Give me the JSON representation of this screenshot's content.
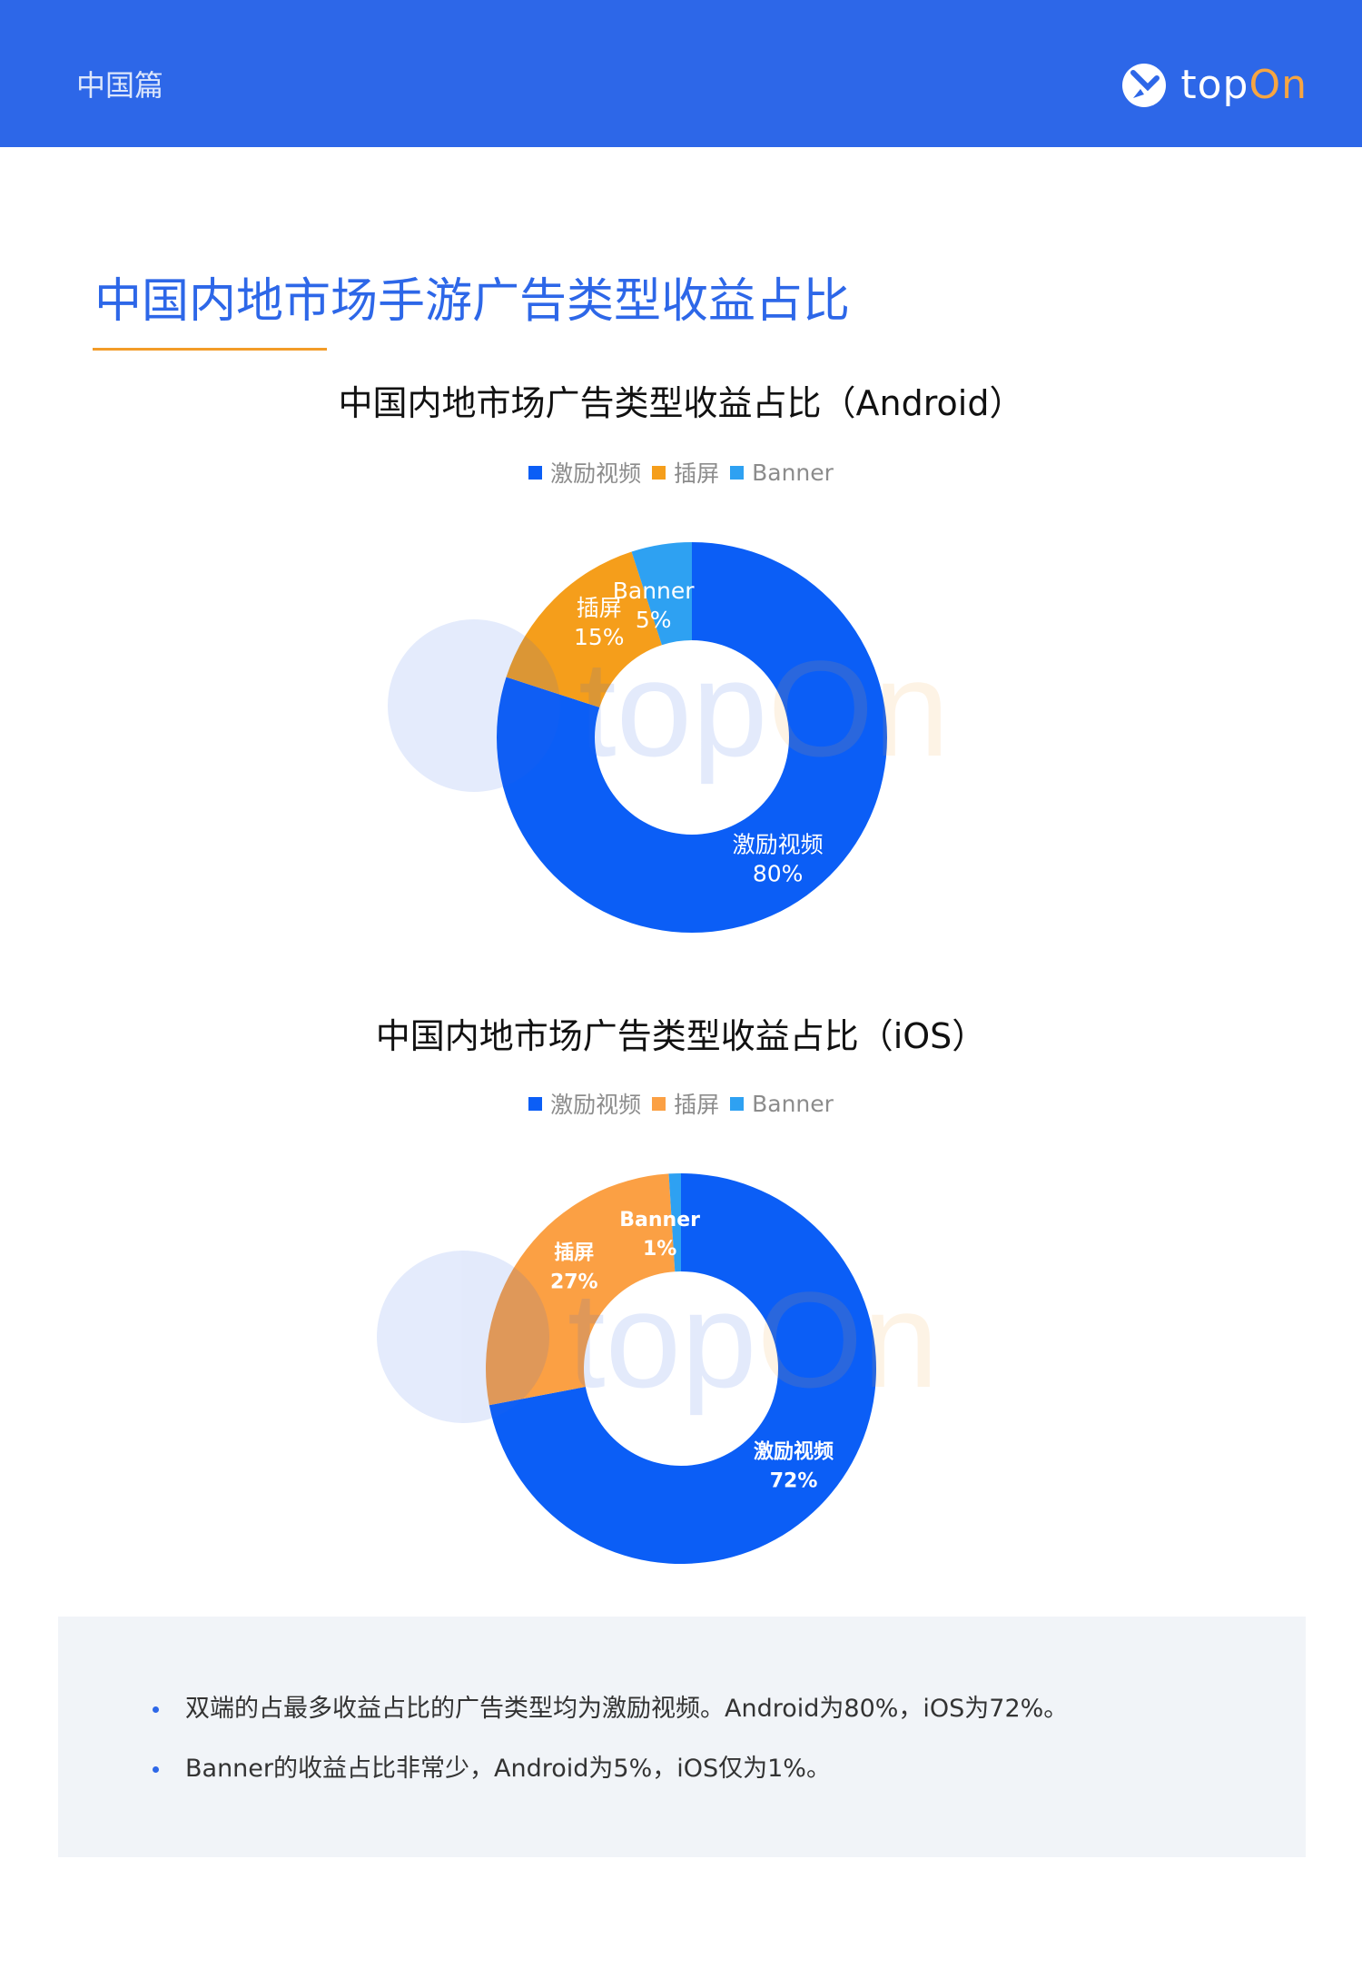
{
  "header": {
    "section": "中国篇",
    "brand_prefix": "top",
    "brand_suffix": "On",
    "brand_color": "#2d67e8",
    "accent_color": "#f7a541"
  },
  "page_title": "中国内地市场手游广告类型收益占比",
  "chart_data": [
    {
      "type": "pie",
      "variant": "donut",
      "title": "中国内地市场广告类型收益占比（Android）",
      "legend_position": "top",
      "categories": [
        "激励视频",
        "插屏",
        "Banner"
      ],
      "values": [
        80,
        15,
        5
      ],
      "labels": [
        "80%",
        "15%",
        "5%"
      ],
      "colors": [
        "#0b5ef6",
        "#f59e1b",
        "#2ea1f2"
      ]
    },
    {
      "type": "pie",
      "variant": "donut",
      "title": "中国内地市场广告类型收益占比（iOS）",
      "legend_position": "top",
      "categories": [
        "激励视频",
        "插屏",
        "Banner"
      ],
      "values": [
        72,
        27,
        1
      ],
      "labels": [
        "72%",
        "27%",
        "1%"
      ],
      "colors": [
        "#0b5ef6",
        "#fba044",
        "#2ea1f2"
      ]
    }
  ],
  "summary": {
    "points": [
      "双端的占最多收益占比的广告类型均为激励视频。Android为80%，iOS为72%。",
      "Banner的收益占比非常少，Android为5%，iOS仅为1%。"
    ]
  }
}
